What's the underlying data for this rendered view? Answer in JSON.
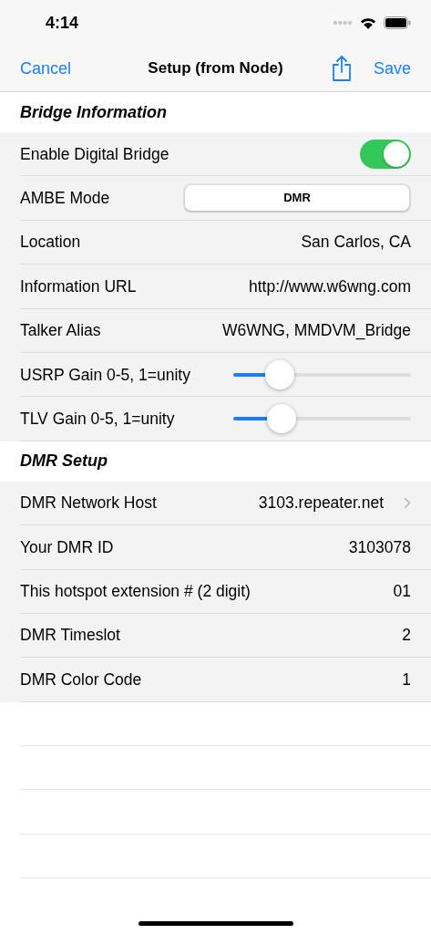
{
  "status_bar": {
    "time": "4:14"
  },
  "nav": {
    "cancel": "Cancel",
    "title": "Setup (from Node)",
    "save": "Save"
  },
  "sections": [
    {
      "title": "Bridge Information",
      "rows": [
        {
          "kind": "toggle",
          "label": "Enable Digital Bridge",
          "on": true
        },
        {
          "kind": "segmented",
          "label": "AMBE Mode",
          "segments": [
            {
              "label": "DMR",
              "selected": true
            }
          ]
        },
        {
          "kind": "value",
          "label": "Location",
          "value": "San Carlos, CA"
        },
        {
          "kind": "value",
          "label": "Information URL",
          "value": "http://www.w6wng.com"
        },
        {
          "kind": "value",
          "label": "Talker Alias",
          "value": "W6WNG, MMDVM_Bridge"
        },
        {
          "kind": "slider",
          "label": "USRP Gain 0-5, 1=unity",
          "level": 0.26
        },
        {
          "kind": "slider",
          "label": "TLV Gain 0-5, 1=unity",
          "level": 0.27
        }
      ]
    },
    {
      "title": "DMR Setup",
      "rows": [
        {
          "kind": "disclosure",
          "label": "DMR Network Host",
          "value": "3103.repeater.net"
        },
        {
          "kind": "value",
          "label": "Your DMR ID",
          "value": "3103078"
        },
        {
          "kind": "value",
          "label": "This hotspot extension # (2 digit)",
          "value": "01"
        },
        {
          "kind": "value",
          "label": "DMR Timeslot",
          "value": "2"
        },
        {
          "kind": "value",
          "label": "DMR Color Code",
          "value": "1"
        }
      ]
    }
  ]
}
